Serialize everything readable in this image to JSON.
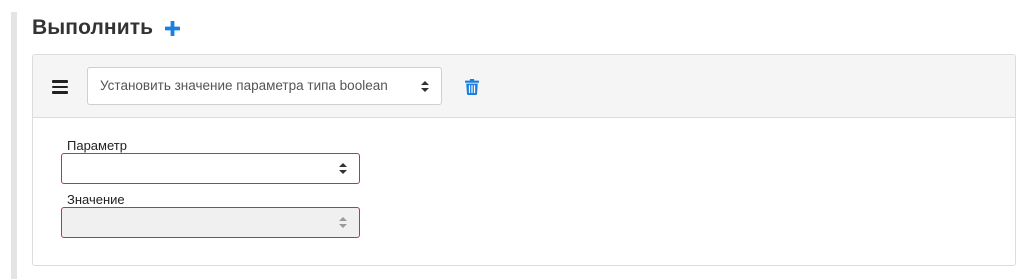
{
  "header": {
    "title": "Выполнить",
    "add_icon": "plus-icon",
    "accent_color": "#1a7fe0"
  },
  "action": {
    "drag_icon": "drag-handle-icon",
    "selected_value": "Установить значение параметра типа boolean",
    "delete_icon": "trash-icon"
  },
  "fields": {
    "parameter": {
      "label": "Параметр",
      "value": "",
      "disabled": false
    },
    "value": {
      "label": "Значение",
      "value": "",
      "disabled": true
    }
  },
  "colors": {
    "invalid_border": "#b33a47",
    "disabled_bg": "#f0f0f0",
    "card_header_bg": "#f5f5f5"
  }
}
